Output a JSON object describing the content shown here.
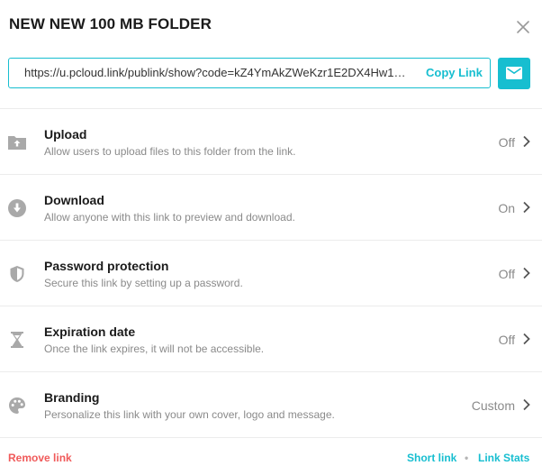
{
  "dialog": {
    "title": "NEW NEW 100 MB FOLDER",
    "icons": {
      "close": "close-icon",
      "mail": "mail-icon"
    }
  },
  "link": {
    "url": "https://u.pcloud.link/publink/show?code=kZ4YmAkZWeKzr1E2DX4Hw1…",
    "copy_label": "Copy Link"
  },
  "settings": [
    {
      "icon": "upload-folder-icon",
      "title": "Upload",
      "description": "Allow users to upload files to this folder from the link.",
      "status": "Off"
    },
    {
      "icon": "download-icon",
      "title": "Download",
      "description": "Allow anyone with this link to preview and download.",
      "status": "On"
    },
    {
      "icon": "shield-icon",
      "title": "Password protection",
      "description": "Secure this link by setting up a password.",
      "status": "Off"
    },
    {
      "icon": "hourglass-icon",
      "title": "Expiration date",
      "description": "Once the link expires, it will not be accessible.",
      "status": "Off"
    },
    {
      "icon": "palette-icon",
      "title": "Branding",
      "description": "Personalize this link with your own cover, logo and message.",
      "status": "Custom"
    }
  ],
  "footer": {
    "remove_label": "Remove link",
    "short_label": "Short link",
    "separator": "•",
    "stats_label": "Link Stats"
  },
  "colors": {
    "accent": "#17bed0",
    "danger": "#f05a5a",
    "muted": "#8a8a8a"
  }
}
